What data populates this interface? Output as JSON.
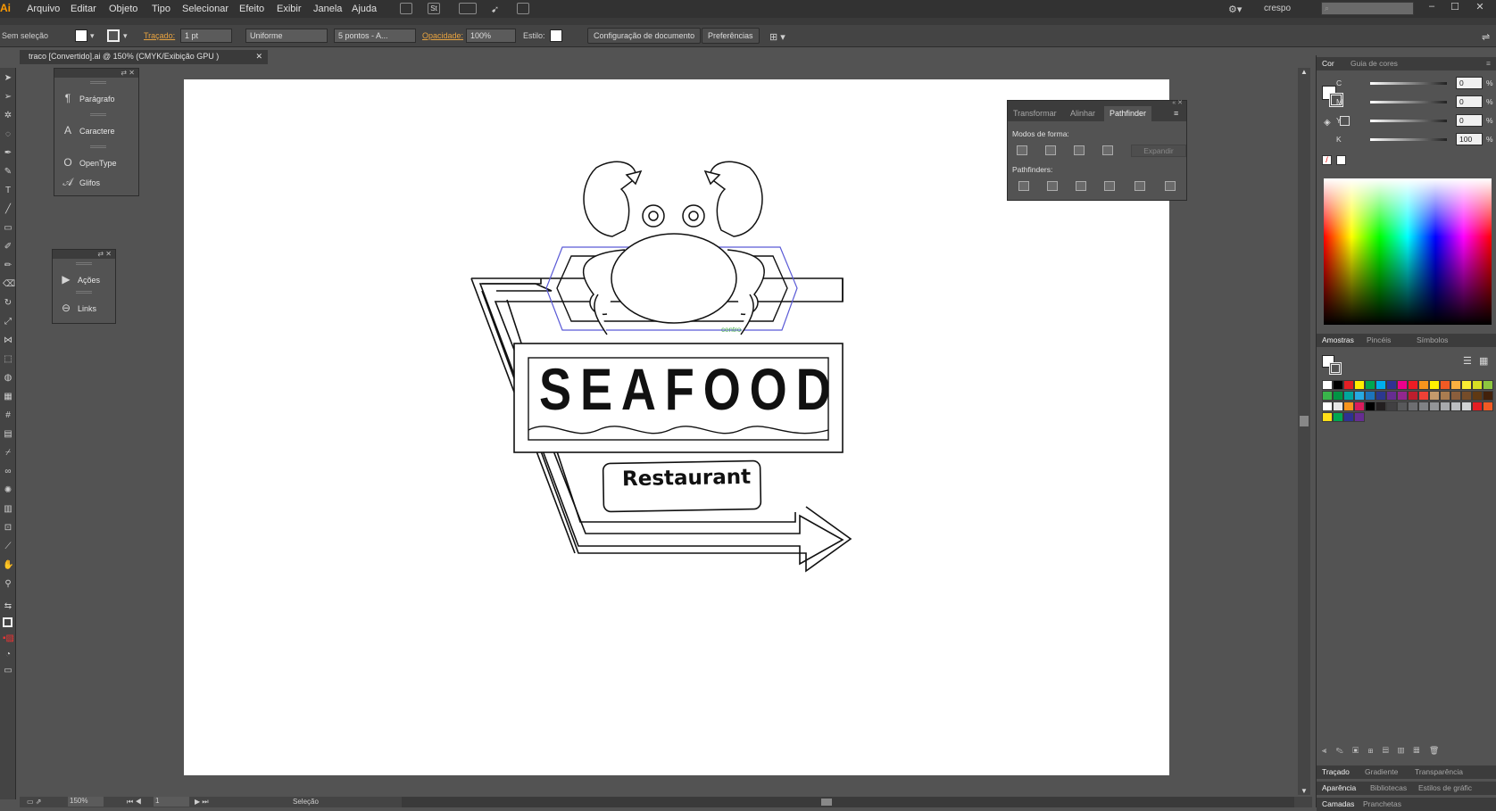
{
  "app": {
    "logo": "Ai"
  },
  "menubar": {
    "items": [
      "Arquivo",
      "Editar",
      "Objeto",
      "Tipo",
      "Selecionar",
      "Efeito",
      "Exibir",
      "Janela",
      "Ajuda"
    ],
    "workspace": "crespo",
    "st_label": "St"
  },
  "controlbar": {
    "selection_status": "Sem seleção",
    "stroke_label": "Traçado:",
    "stroke_weight": "1 pt",
    "stroke_profile": "Uniforme",
    "brush": "5 pontos - A...",
    "opacity_label": "Opacidade:",
    "opacity_value": "100%",
    "style_label": "Estilo:",
    "doc_settings_button": "Configuração de documento",
    "preferences_button": "Preferências"
  },
  "document": {
    "tab_title": "traco [Convertido].ai @ 150% (CMYK/Exibição GPU )"
  },
  "panels": {
    "type": [
      "Parágrafo",
      "Caractere",
      "OpenType",
      "Glifos"
    ],
    "actions": [
      "Ações",
      "Links"
    ]
  },
  "pathfinder": {
    "tabs": [
      "Transformar",
      "Alinhar",
      "Pathfinder"
    ],
    "active_tab": "Pathfinder",
    "shape_modes_label": "Modos de forma:",
    "expand_button": "Expandir",
    "pathfinders_label": "Pathfinders:"
  },
  "color_panel": {
    "tabs": [
      "Cor",
      "Guia de cores"
    ],
    "channels": [
      {
        "label": "C",
        "value": "0"
      },
      {
        "label": "M",
        "value": "0"
      },
      {
        "label": "Y",
        "value": "0"
      },
      {
        "label": "K",
        "value": "100"
      }
    ],
    "pct": "%"
  },
  "swatches_panel": {
    "tabs": [
      "Amostras",
      "Pincéis",
      "Símbolos"
    ],
    "colors": [
      "#ffffff",
      "#000000",
      "#e31e24",
      "#ffed00",
      "#00a651",
      "#00aeef",
      "#2e3192",
      "#ec008c",
      "#ed1c24",
      "#f7941d",
      "#fff200",
      "#f15a24",
      "#fbb040",
      "#f9ed32",
      "#d7df23",
      "#8dc63f",
      "#39b54a",
      "#009444",
      "#00a79d",
      "#27aae1",
      "#1c75bc",
      "#2b388f",
      "#662d91",
      "#92278f",
      "#be1e2d",
      "#ef4136",
      "#c49a6c",
      "#a97c50",
      "#8b5e3c",
      "#754c29",
      "#603913",
      "#42210b",
      "#ffffff",
      "#e6e6e6",
      "#f7941d",
      "#da1c5c",
      "#000000",
      "#231f20",
      "#414042",
      "#58595b",
      "#6d6e71",
      "#808285",
      "#939598",
      "#a7a9ac",
      "#bcbec0",
      "#d1d3d4",
      "#e31e24",
      "#f15a24",
      "#ffde17",
      "#00a651",
      "#2e3192",
      "#662d91"
    ]
  },
  "bottom_panels": {
    "row1": [
      "Traçado",
      "Gradiente",
      "Transparência"
    ],
    "row2": [
      "Aparência",
      "Bibliotecas",
      "Estilos de gráfic"
    ],
    "row3": [
      "Camadas",
      "Pranchetas"
    ]
  },
  "statusbar": {
    "zoom": "150%",
    "page": "1",
    "tool": "Seleção"
  },
  "artwork": {
    "headline": "SEAFOOD",
    "subline": "Restaurant"
  }
}
